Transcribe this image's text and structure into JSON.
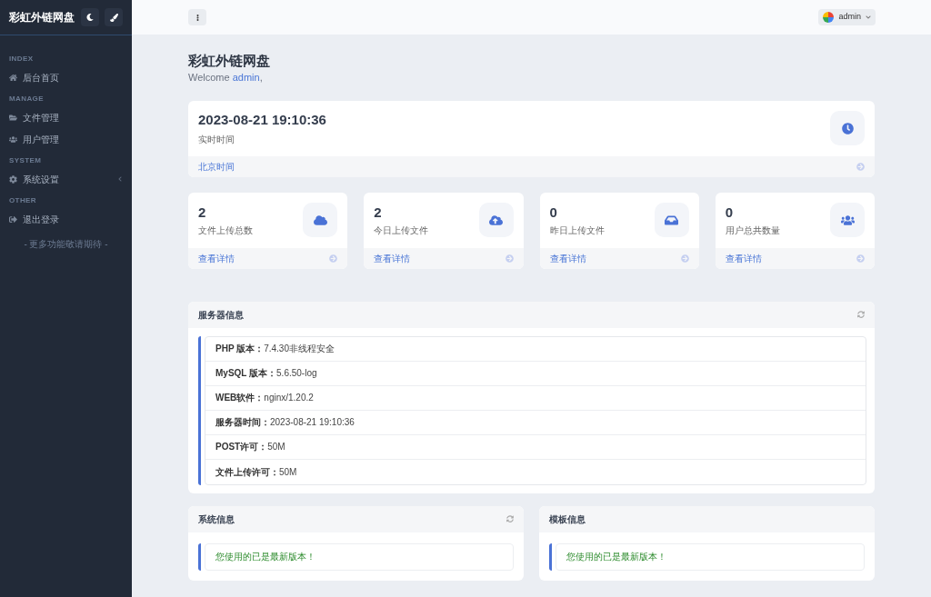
{
  "sidebar": {
    "brand": "彩虹外链网盘",
    "sections": [
      {
        "heading": "INDEX",
        "items": [
          {
            "kind": "home",
            "label": "后台首页",
            "submenu": false
          }
        ]
      },
      {
        "heading": "MANAGE",
        "items": [
          {
            "kind": "folder",
            "label": "文件管理",
            "submenu": false
          },
          {
            "kind": "users",
            "label": "用户管理",
            "submenu": false
          }
        ]
      },
      {
        "heading": "SYSTEM",
        "items": [
          {
            "kind": "gear",
            "label": "系统设置",
            "submenu": true
          }
        ]
      },
      {
        "heading": "OTHER",
        "items": [
          {
            "kind": "logout",
            "label": "退出登录",
            "submenu": false
          }
        ]
      }
    ],
    "footer": "- 更多功能敬请期待 -"
  },
  "header": {
    "user": "admin"
  },
  "page": {
    "title": "彩虹外链网盘",
    "welcome": "Welcome ",
    "user": "admin",
    "after": ","
  },
  "clock": {
    "value": "2023-08-21 19:10:36",
    "label": "实时时间",
    "footer": "北京时间"
  },
  "stats": [
    {
      "kind": "cloud",
      "value": "2",
      "label": "文件上传总数",
      "link": "查看详情"
    },
    {
      "kind": "upload",
      "value": "2",
      "label": "今日上传文件",
      "link": "查看详情"
    },
    {
      "kind": "inbox",
      "value": "0",
      "label": "昨日上传文件",
      "link": "查看详情"
    },
    {
      "kind": "users",
      "value": "0",
      "label": "用户总共数量",
      "link": "查看详情"
    }
  ],
  "server": {
    "title": "服务器信息",
    "rows": [
      {
        "label": "PHP 版本：",
        "value": "7.4.30非线程安全"
      },
      {
        "label": "MySQL 版本：",
        "value": "5.6.50-log"
      },
      {
        "label": "WEB软件：",
        "value": "nginx/1.20.2"
      },
      {
        "label": "服务器时间：",
        "value": "2023-08-21 19:10:36"
      },
      {
        "label": "POST许可：",
        "value": "50M"
      },
      {
        "label": "文件上传许可：",
        "value": "50M"
      }
    ]
  },
  "panels": [
    {
      "title": "系统信息",
      "refresh_icon": true,
      "message": "您使用的已是最新版本！"
    },
    {
      "title": "模板信息",
      "refresh_icon": false,
      "message": "您使用的已是最新版本！"
    }
  ]
}
